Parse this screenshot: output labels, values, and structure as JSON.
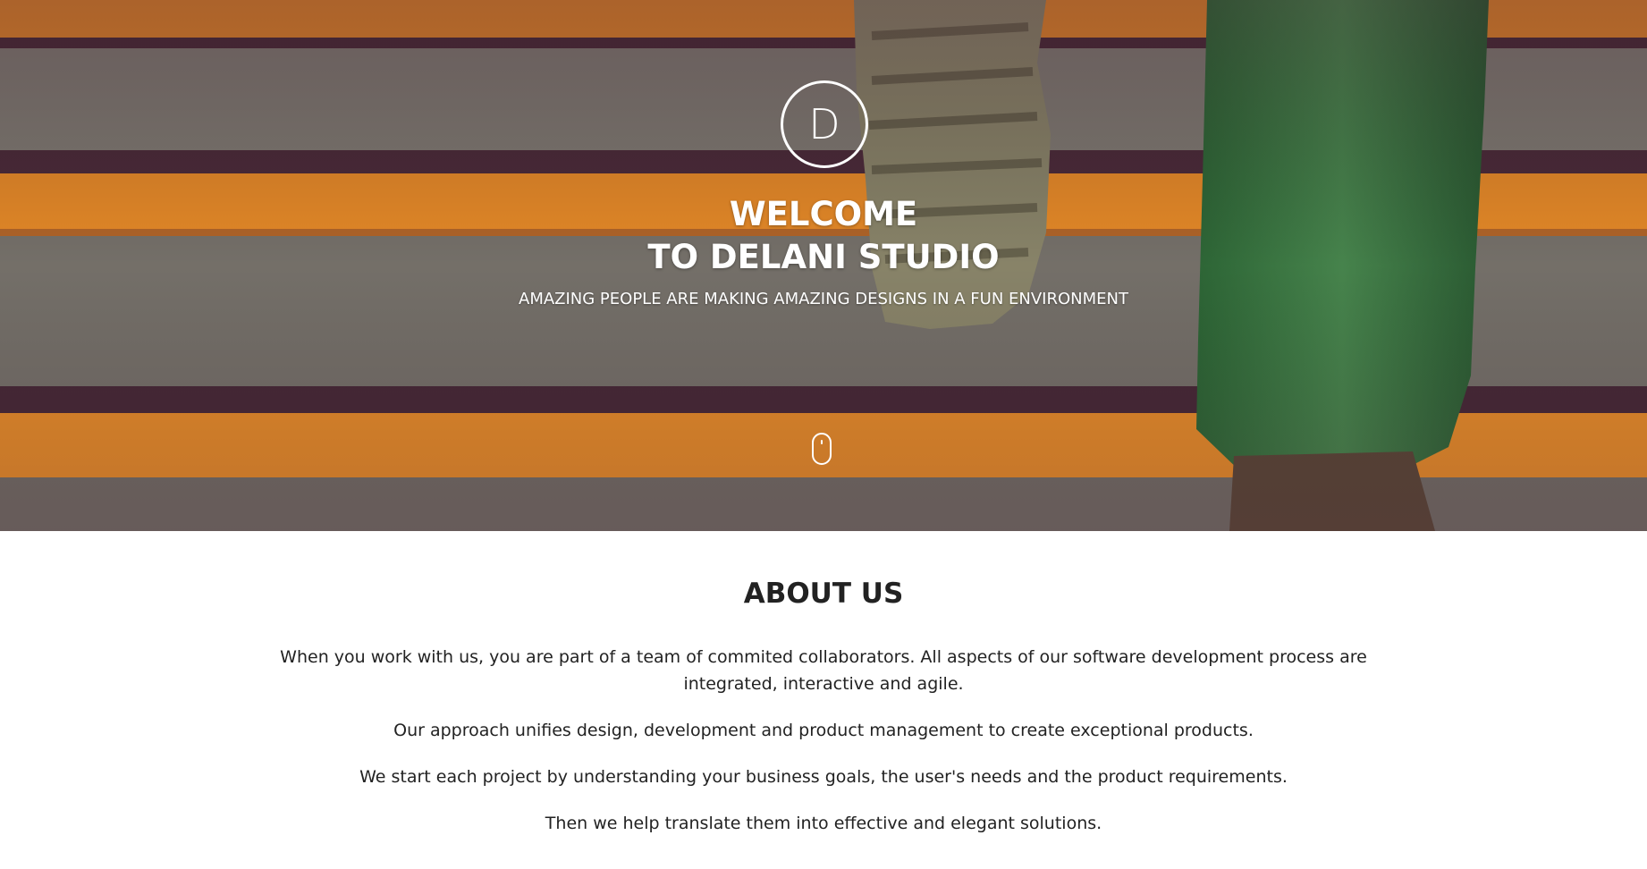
{
  "hero": {
    "logo_letter": "D",
    "title_line1": "WELCOME",
    "title_line2": "TO DELANI STUDIO",
    "subtitle": "AMAZING PEOPLE ARE MAKING AMAZING DESIGNS IN A FUN ENVIRONMENT",
    "scroll_icon": "mouse-icon",
    "background_image": "orange-striped-stairs-with-sneaker-and-jeans"
  },
  "about": {
    "title": "ABOUT US",
    "paragraphs": [
      "When you work with us, you are part of a team of commited collaborators. All aspects of our software development process are integrated, interactive and agile.",
      "Our approach unifies design, development and product management to create exceptional products.",
      "We start each project by understanding your business goals, the user's needs and the product requirements.",
      "Then we help translate them into effective and elegant solutions."
    ]
  },
  "colors": {
    "hero_orange": "#f0902a",
    "hero_gray": "#7a7670",
    "jeans_green": "#3c7a44",
    "text_dark": "#222222",
    "white": "#ffffff"
  }
}
